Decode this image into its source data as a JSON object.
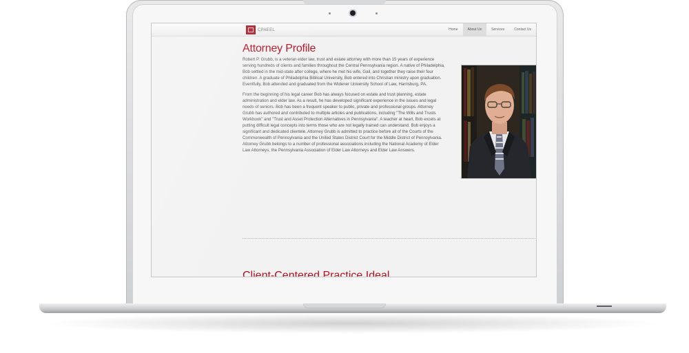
{
  "site": {
    "logo_text": "CPAEEL",
    "nav": [
      {
        "label": "Home",
        "active": false
      },
      {
        "label": "About Us",
        "active": true
      },
      {
        "label": "Services",
        "active": false
      },
      {
        "label": "Contact Us",
        "active": false
      }
    ]
  },
  "profile": {
    "title": "Attorney Profile",
    "paragraphs": [
      "Robert P. Grubb, is a veteran elder law, trust and estate attorney with more than 15 years of experience serving hundreds of clients and families throughout the Central Pennsylvania region. A native of Philadelphia, Bob settled in the mid-state after college, where he met his wife, Gail, and together they raise their four children. A graduate of Philadelphia Biblical University, Bob entered into Christian ministry upon graduation. Eventfully, Bob attended and graduated from the Widener University School of Law, Harrisburg, PA.",
      "From the beginning of his legal career Bob has always focused on estate and trust planning, estate administration and elder law. As a result, he has developed significant experience in the issues and legal needs of seniors. Bob has been a frequent speaker to public, private and professional groups. Attorney Grubb has authored and contributed to multiple articles and publications, including \"The Wills and Trusts Workbook\" and \"Trust and Asset Protection Alternatives in Pennsylvania\". A teacher at heart, Bob excels at putting difficult legal concepts into terms those who are not legally trained can understand. Bob enjoys a significant and dedicated clientele. Attorney Grubb is admitted to practice before all of the Courts of the Commonwealth of Pennsylvania and the United States District Court for the Middle District of Pennsylvania. Attorney Grubb belongs to a number of professional associations including the National Academy of Elder Law Attorneys, the Pennsylvania Association of Elder Law Attorneys and Elder Law Answers."
    ]
  },
  "next_section_title": "Client-Centered Practice Ideal",
  "colors": {
    "accent": "#b4101e",
    "body_text": "#555555",
    "device_silver": "#cfd0d2"
  }
}
